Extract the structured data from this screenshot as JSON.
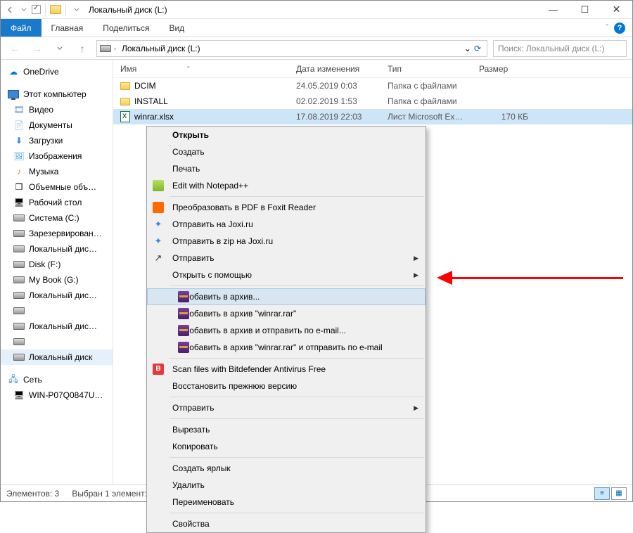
{
  "title": "Локальный диск (L:)",
  "ribbon": {
    "file": "Файл",
    "home": "Главная",
    "share": "Поделиться",
    "view": "Вид"
  },
  "address": {
    "location": "Локальный диск (L:)"
  },
  "search": {
    "placeholder": "Поиск: Локальный диск (L:)"
  },
  "sidebar": {
    "onedrive": "OneDrive",
    "thispc": "Этот компьютер",
    "items": [
      "Видео",
      "Документы",
      "Загрузки",
      "Изображения",
      "Музыка",
      "Объемные объ…",
      "Рабочий стол",
      "Система (C:)",
      "Зарезервирован…",
      "Локальный дис…",
      "Disk (F:)",
      "My Book (G:)",
      "Локальный дис…",
      "",
      "Локальный дис…",
      "",
      "Локальный диск"
    ],
    "network": "Сеть",
    "network_pc": "WIN-P07Q0847U…"
  },
  "columns": {
    "name": "Имя",
    "date": "Дата изменения",
    "type": "Тип",
    "size": "Размер"
  },
  "rows": [
    {
      "name": "DCIM",
      "date": "24.05.2019 0:03",
      "type": "Папка с файлами",
      "size": "",
      "icon": "folder"
    },
    {
      "name": "INSTALL",
      "date": "02.02.2019 1:53",
      "type": "Папка с файлами",
      "size": "",
      "icon": "folder"
    },
    {
      "name": "winrar.xlsx",
      "date": "17.08.2019 22:03",
      "type": "Лист Microsoft Ex…",
      "size": "170 КБ",
      "icon": "xlsx",
      "selected": true
    }
  ],
  "context_menu": [
    {
      "label": "Открыть",
      "bold": true
    },
    {
      "label": "Создать"
    },
    {
      "label": "Печать"
    },
    {
      "label": "Edit with Notepad++",
      "icon": "npp"
    },
    {
      "sep": true
    },
    {
      "label": "Преобразовать в PDF в Foxit Reader",
      "icon": "foxit"
    },
    {
      "label": "Отправить на Joxi.ru",
      "icon": "joxi"
    },
    {
      "label": "Отправить в zip на Joxi.ru",
      "icon": "joxi"
    },
    {
      "label": "Отправить",
      "icon": "share",
      "submenu": true
    },
    {
      "label": "Открыть с помощью",
      "submenu": true
    },
    {
      "sep": true
    },
    {
      "label": "Добавить в архив...",
      "icon": "winrar",
      "hover": true
    },
    {
      "label": "Добавить в архив \"winrar.rar\"",
      "icon": "winrar"
    },
    {
      "label": "Добавить в архив и отправить по e-mail...",
      "icon": "winrar"
    },
    {
      "label": "Добавить в архив \"winrar.rar\" и отправить по e-mail",
      "icon": "winrar"
    },
    {
      "sep": true
    },
    {
      "label": "Scan files with Bitdefender Antivirus Free",
      "icon": "bitd"
    },
    {
      "label": "Восстановить прежнюю версию"
    },
    {
      "sep": true
    },
    {
      "label": "Отправить",
      "submenu": true
    },
    {
      "sep": true
    },
    {
      "label": "Вырезать"
    },
    {
      "label": "Копировать"
    },
    {
      "sep": true
    },
    {
      "label": "Создать ярлык"
    },
    {
      "label": "Удалить"
    },
    {
      "label": "Переименовать"
    },
    {
      "sep": true
    },
    {
      "label": "Свойства"
    }
  ],
  "status": {
    "count": "Элементов: 3",
    "selected": "Выбран 1 элемент:"
  }
}
